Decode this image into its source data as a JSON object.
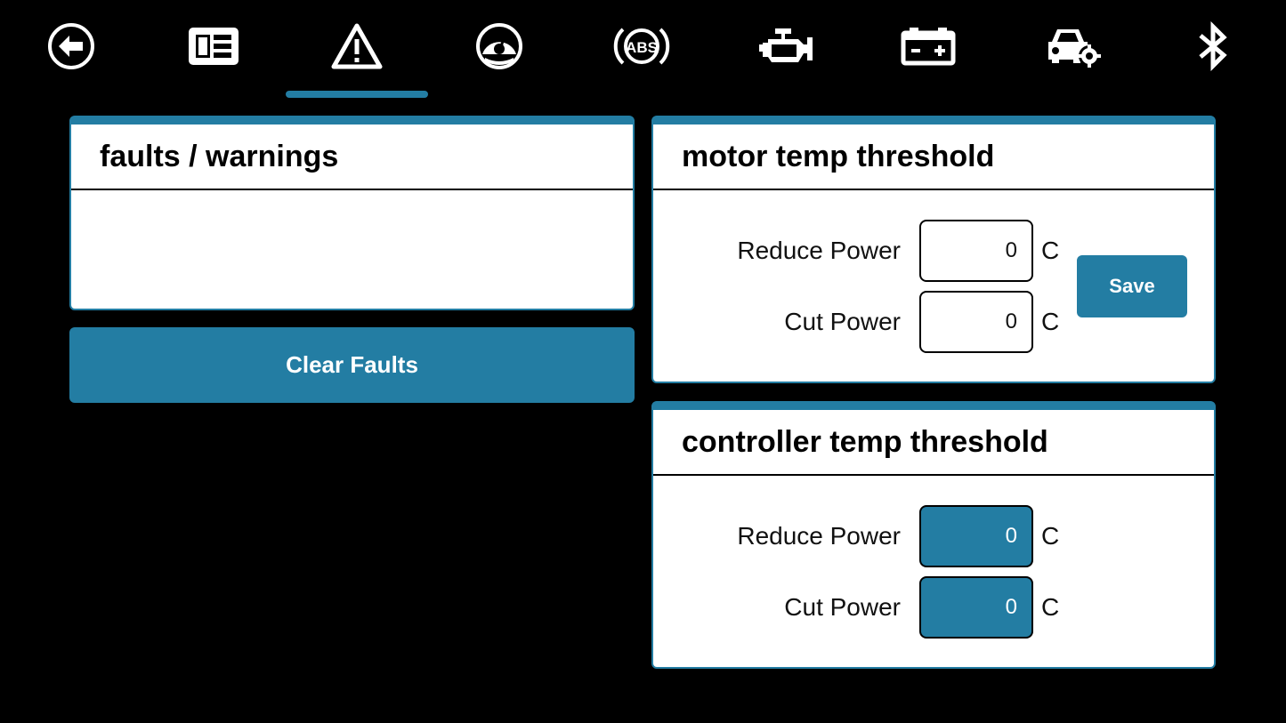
{
  "nav": {
    "items": [
      {
        "icon": "back-arrow-icon"
      },
      {
        "icon": "dashboard-layout-icon"
      },
      {
        "icon": "warning-triangle-icon",
        "active": true
      },
      {
        "icon": "speedometer-icon"
      },
      {
        "icon": "abs-icon"
      },
      {
        "icon": "engine-icon"
      },
      {
        "icon": "battery-icon"
      },
      {
        "icon": "car-settings-icon"
      },
      {
        "icon": "bluetooth-icon"
      }
    ]
  },
  "colors": {
    "accent": "#237da3",
    "background": "#000000",
    "panel": "#ffffff"
  },
  "faults": {
    "title": "faults / warnings",
    "clear_label": "Clear Faults"
  },
  "motor": {
    "title": "motor temp threshold",
    "reduce_label": "Reduce Power",
    "reduce_value": "0",
    "cut_label": "Cut Power",
    "cut_value": "0",
    "unit": "C",
    "save_label": "Save"
  },
  "controller": {
    "title": "controller temp threshold",
    "reduce_label": "Reduce Power",
    "reduce_value": "0",
    "cut_label": "Cut Power",
    "cut_value": "0",
    "unit": "C"
  }
}
